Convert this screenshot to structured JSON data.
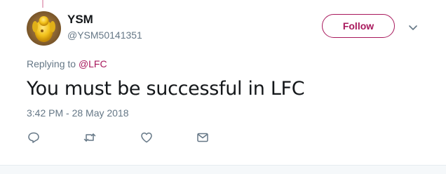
{
  "tweet": {
    "display_name": "YSM",
    "handle": "@YSM50141351",
    "follow_label": "Follow",
    "replying_prefix": "Replying to",
    "replying_to": "@LFC",
    "text": "You must be successful in LFC",
    "timestamp": "3:42 PM - 28 May 2018"
  },
  "actions": [
    {
      "icon": "reply-icon"
    },
    {
      "icon": "retweet-icon"
    },
    {
      "icon": "like-icon"
    },
    {
      "icon": "direct-message-icon"
    }
  ],
  "colors": {
    "accent": "#a8185c",
    "secondary_text": "#657786",
    "primary_text": "#14171a",
    "icon": "#657786"
  }
}
